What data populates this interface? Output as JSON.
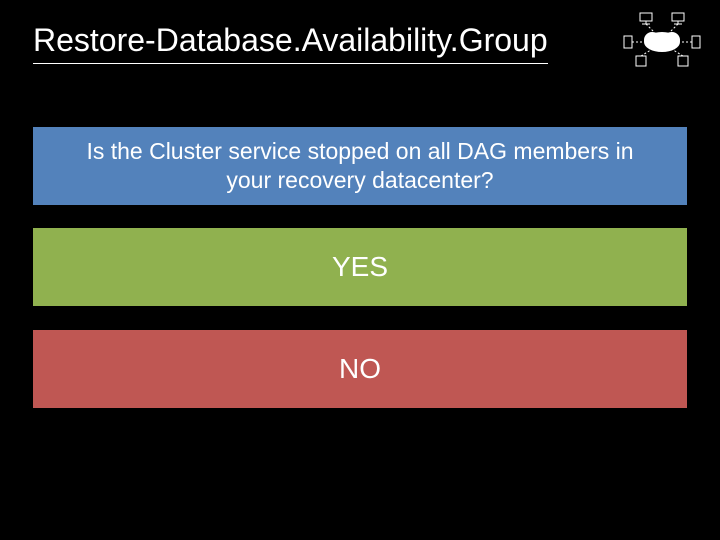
{
  "title": "Restore-Database.Availability.Group",
  "question": "Is the Cluster service stopped on all DAG members in your recovery datacenter?",
  "yes_label": "YES",
  "no_label": "NO",
  "icon_name": "network-cloud-icon",
  "colors": {
    "bg": "#000000",
    "question_bg": "#5382bb",
    "yes_bg": "#90b14f",
    "no_bg": "#bf5753",
    "text": "#ffffff"
  }
}
